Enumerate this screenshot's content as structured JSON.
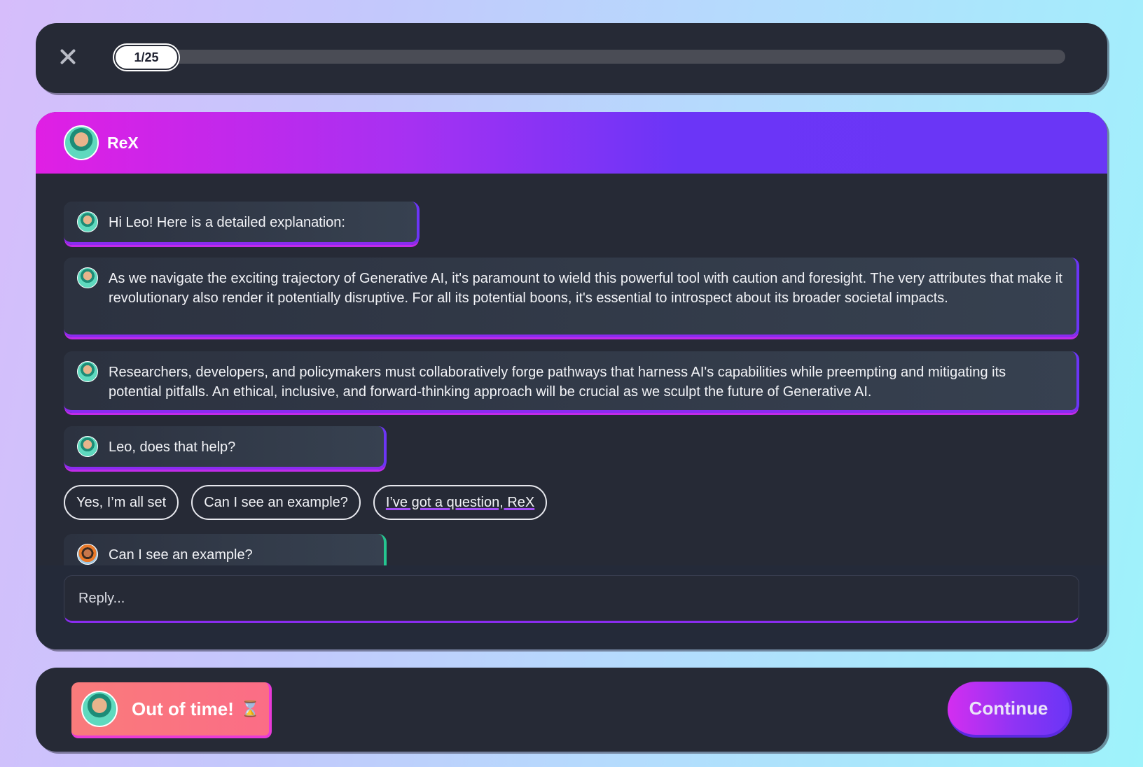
{
  "progress": {
    "label": "1/25",
    "current": 1,
    "total": 25
  },
  "header": {
    "bot_name": "ReX"
  },
  "messages": [
    {
      "sender": "bot",
      "text": "Hi Leo! Here is a detailed explanation:"
    },
    {
      "sender": "bot",
      "text": "As we navigate the exciting trajectory of Generative AI, it's paramount to wield this powerful tool with caution and foresight. The very attributes that make it revolutionary also render it potentially disruptive. For all its potential boons, it's essential to introspect about its broader societal impacts."
    },
    {
      "sender": "bot",
      "text": "Researchers, developers, and policymakers must collaboratively forge pathways that harness AI's capabilities while preempting and mitigating its potential pitfalls. An ethical, inclusive, and forward-thinking approach will be crucial as we sculpt the future of Generative AI."
    },
    {
      "sender": "bot",
      "text": "Leo, does that help?"
    },
    {
      "sender": "user",
      "text": "Can I see an example?"
    }
  ],
  "quick_replies": [
    "Yes, I’m all set",
    "Can I see an example?",
    "I’ve got a question, ReX"
  ],
  "reply": {
    "placeholder": "Reply..."
  },
  "footer": {
    "status_text": "Out of time!",
    "status_icon": "hourglass-icon",
    "continue_label": "Continue"
  },
  "colors": {
    "header_gradient_start": "#e01fe4",
    "header_gradient_end": "#6a36f6",
    "panel_bg": "#262a36",
    "timeout_bg": "#f97b7b",
    "user_accent": "#25c690"
  }
}
